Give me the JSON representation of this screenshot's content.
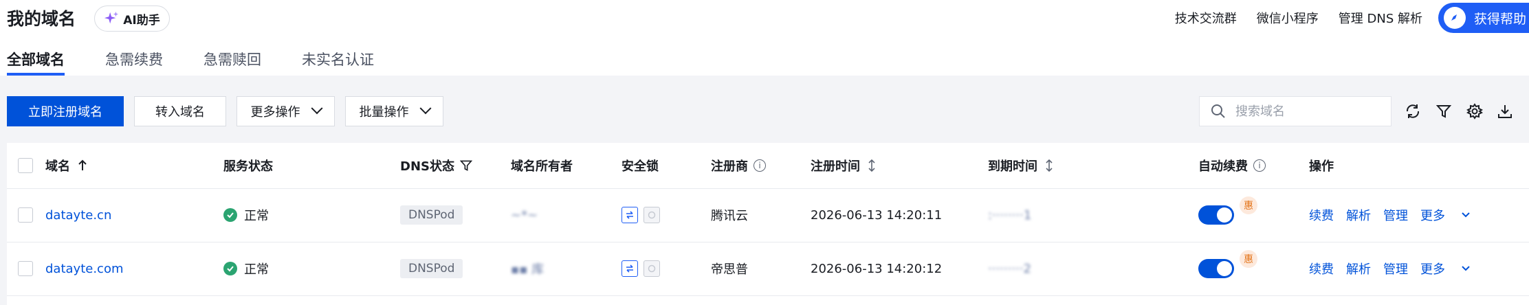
{
  "page": {
    "title": "我的域名",
    "ai_button_label": "AI助手",
    "top_links": [
      "技术交流群",
      "微信小程序",
      "管理 DNS 解析"
    ],
    "help_label": "获得帮助",
    "tabs": [
      {
        "label": "全部域名",
        "active": true
      },
      {
        "label": "急需续费",
        "active": false
      },
      {
        "label": "急需赎回",
        "active": false
      },
      {
        "label": "未实名认证",
        "active": false
      }
    ]
  },
  "toolbar": {
    "register_label": "立即注册域名",
    "transfer_label": "转入域名",
    "more_label": "更多操作",
    "batch_label": "批量操作",
    "search_placeholder": "搜索域名"
  },
  "table": {
    "columns": {
      "domain": "域名",
      "service_status": "服务状态",
      "dns_status": "DNS状态",
      "owner": "域名所有者",
      "lock": "安全锁",
      "registrar": "注册商",
      "reg_time": "注册时间",
      "expire_time": "到期时间",
      "auto_renew": "自动续费",
      "actions": "操作"
    },
    "rows": [
      {
        "domain": "datayte.cn",
        "status": "正常",
        "dns": "DNSPod",
        "owner": "~*~",
        "registrar": "腾讯云",
        "reg_time": "2026-06-13 14:20:11",
        "expire_time": ":········1",
        "badge": "惠",
        "actions": [
          "续费",
          "解析",
          "管理",
          "更多"
        ]
      },
      {
        "domain": "datayte.com",
        "status": "正常",
        "dns": "DNSPod",
        "owner": "▪▪ 库",
        "registrar": "帝思普",
        "reg_time": "2026-06-13 14:20:12",
        "expire_time": "·········2",
        "badge": "惠",
        "actions": [
          "续费",
          "解析",
          "管理",
          "更多"
        ]
      }
    ]
  },
  "colors": {
    "primary": "#0052d9",
    "success": "#2ba471",
    "badge": "#e37318"
  }
}
